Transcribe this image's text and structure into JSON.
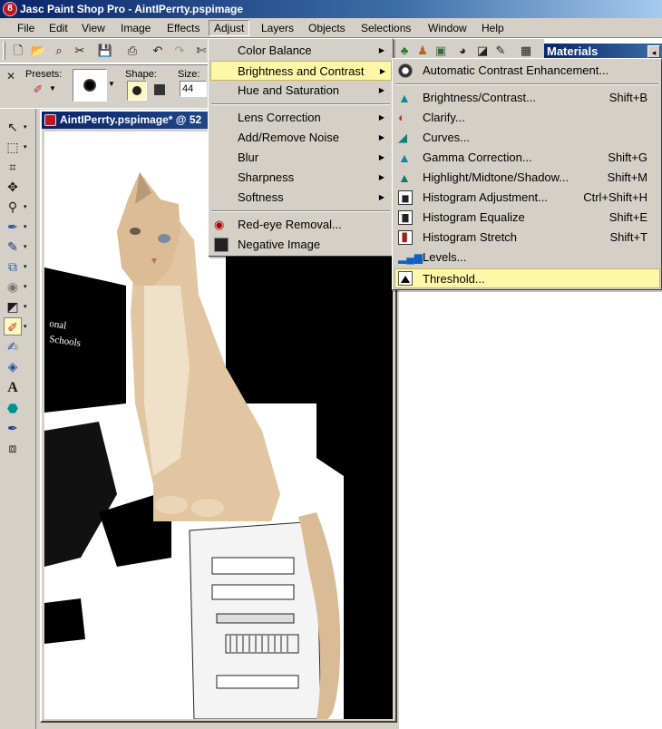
{
  "window": {
    "app_title": "Jasc Paint Shop Pro - AintIPerrty.pspimage",
    "app_icon_glyph": "8"
  },
  "menubar": {
    "items": [
      "File",
      "Edit",
      "View",
      "Image",
      "Effects",
      "Adjust",
      "Layers",
      "Objects",
      "Selections",
      "Window",
      "Help"
    ],
    "active": "Adjust"
  },
  "materials": {
    "title": "Materials"
  },
  "tool_options": {
    "presets_label": "Presets:",
    "shape_label": "Shape:",
    "size_label": "Size:",
    "size_value": "44"
  },
  "image_window": {
    "title": "AintIPerrty.pspimage* @  52"
  },
  "adjust_menu": {
    "items": [
      {
        "label": "Color Balance",
        "submenu": true
      },
      {
        "label": "Brightness and Contrast",
        "submenu": true,
        "highlighted": true
      },
      {
        "label": "Hue and Saturation",
        "submenu": true
      },
      {
        "label": "Lens Correction",
        "submenu": true
      },
      {
        "label": "Add/Remove Noise",
        "submenu": true
      },
      {
        "label": "Blur",
        "submenu": true
      },
      {
        "label": "Sharpness",
        "submenu": true
      },
      {
        "label": "Softness",
        "submenu": true
      },
      {
        "label": "Red-eye Removal...",
        "icon": "red-eye-icon"
      },
      {
        "label": "Negative Image",
        "icon": "negative-image-icon"
      }
    ]
  },
  "brightness_submenu": {
    "items": [
      {
        "label": "Automatic Contrast Enhancement...",
        "shortcut": "",
        "icon": "auto-contrast-icon"
      },
      {
        "label": "Brightness/Contrast...",
        "shortcut": "Shift+B",
        "icon": "brightness-contrast-icon"
      },
      {
        "label": "Clarify...",
        "shortcut": "",
        "icon": "clarify-icon"
      },
      {
        "label": "Curves...",
        "shortcut": "",
        "icon": "curves-icon"
      },
      {
        "label": "Gamma Correction...",
        "shortcut": "Shift+G",
        "icon": "gamma-icon"
      },
      {
        "label": "Highlight/Midtone/Shadow...",
        "shortcut": "Shift+M",
        "icon": "highlight-midtone-icon"
      },
      {
        "label": "Histogram Adjustment...",
        "shortcut": "Ctrl+Shift+H",
        "icon": "histogram-adjust-icon"
      },
      {
        "label": "Histogram Equalize",
        "shortcut": "Shift+E",
        "icon": "histogram-equalize-icon"
      },
      {
        "label": "Histogram Stretch",
        "shortcut": "Shift+T",
        "icon": "histogram-stretch-icon"
      },
      {
        "label": "Levels...",
        "shortcut": "",
        "icon": "levels-icon"
      },
      {
        "label": "Threshold...",
        "shortcut": "",
        "icon": "threshold-icon",
        "highlighted": true
      }
    ]
  },
  "colors": {
    "menu_highlight": "#fff7a8",
    "title_gradient_start": "#0a246a",
    "chrome": "#d4d0c8"
  }
}
